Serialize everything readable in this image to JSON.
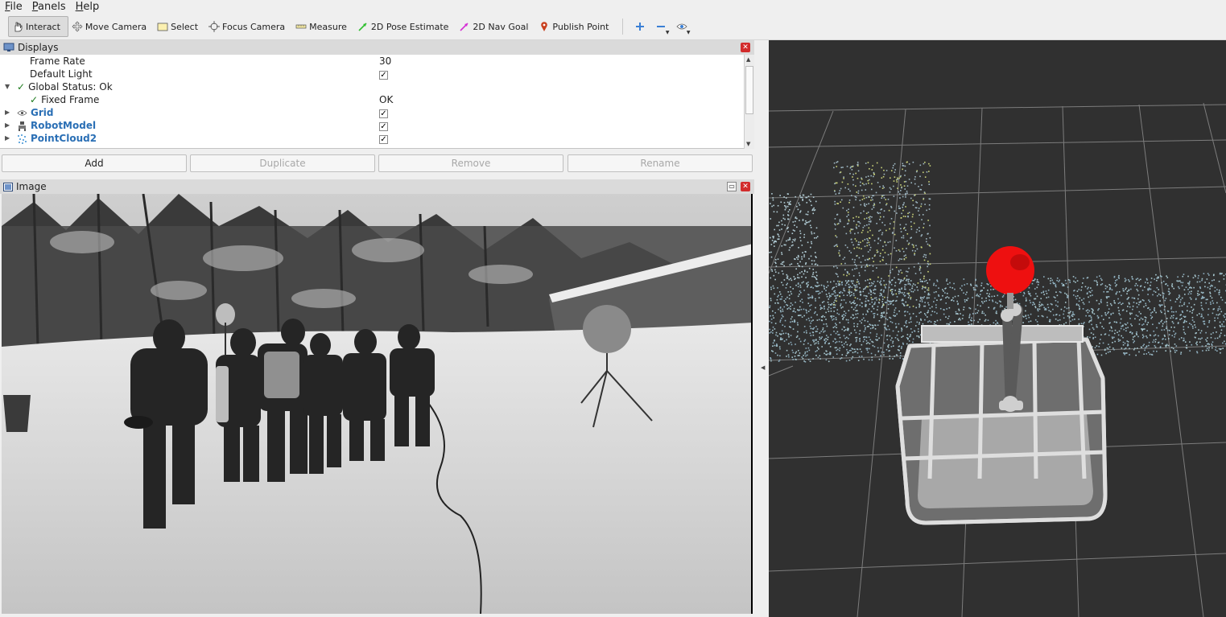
{
  "menu": [
    "File",
    "Panels",
    "Help"
  ],
  "toolbar": {
    "tools": [
      {
        "label": "Interact",
        "icon": "hand-icon",
        "active": true
      },
      {
        "label": "Move Camera",
        "icon": "move-camera-icon",
        "active": false
      },
      {
        "label": "Select",
        "icon": "select-icon",
        "active": false
      },
      {
        "label": "Focus Camera",
        "icon": "focus-camera-icon",
        "active": false
      },
      {
        "label": "Measure",
        "icon": "ruler-icon",
        "active": false
      },
      {
        "label": "2D Pose Estimate",
        "icon": "green-arrow-icon",
        "active": false
      },
      {
        "label": "2D Nav Goal",
        "icon": "magenta-arrow-icon",
        "active": false
      },
      {
        "label": "Publish Point",
        "icon": "map-pin-icon",
        "active": false
      }
    ]
  },
  "displays": {
    "title": "Displays",
    "rows": [
      {
        "label": "Frame Rate",
        "value": "30"
      },
      {
        "label": "Default Light",
        "value": "✓"
      },
      {
        "label": "Global Status: Ok",
        "value": ""
      },
      {
        "label": "Fixed Frame",
        "value": "OK"
      },
      {
        "label": "Grid",
        "value": "✓"
      },
      {
        "label": "RobotModel",
        "value": "✓"
      },
      {
        "label": "PointCloud2",
        "value": "✓"
      }
    ],
    "buttons": {
      "add": "Add",
      "duplicate": "Duplicate",
      "remove": "Remove",
      "rename": "Rename"
    }
  },
  "image_panel": {
    "title": "Image"
  },
  "colors": {
    "accent_blue": "#2a6fb5",
    "close_red": "#d22c2c",
    "status_green": "#1b7a1b",
    "marker_red": "#ee1010"
  }
}
